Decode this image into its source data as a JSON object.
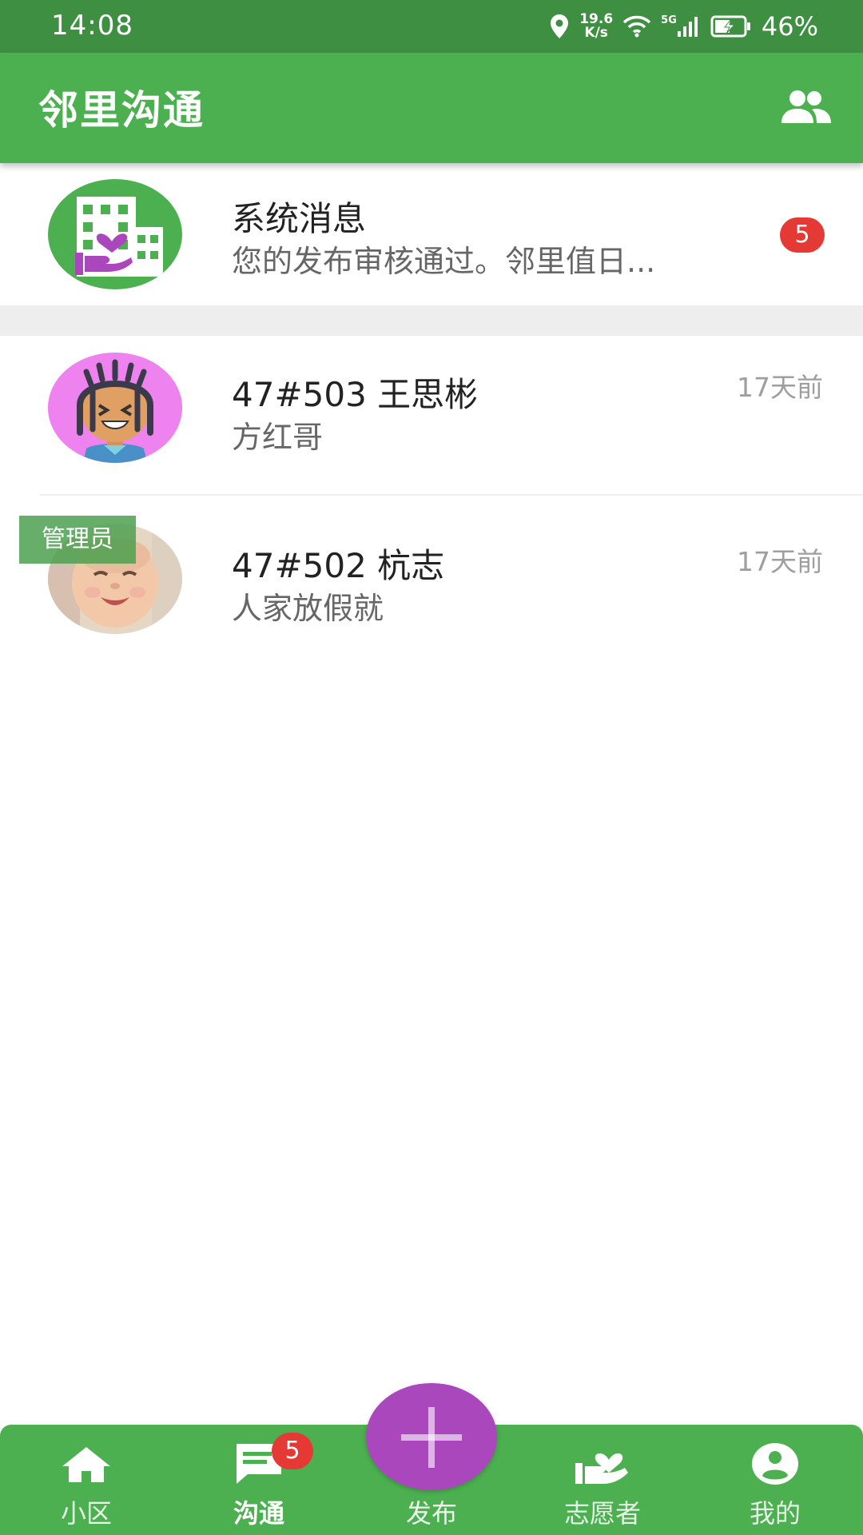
{
  "status_bar": {
    "time": "14:08",
    "net_speed_value": "19.6",
    "net_speed_unit": "K/s",
    "signal_label": "5G",
    "battery": "46%",
    "icons": [
      "location-icon",
      "wifi-icon",
      "signal-icon",
      "battery-charging-icon"
    ]
  },
  "app_bar": {
    "title": "邻里沟通",
    "action_icon": "contacts-icon"
  },
  "conversations": [
    {
      "name": "系统消息",
      "preview": "您的发布审核通过。邻里值日...",
      "unread": "5",
      "time": "",
      "avatar": "system-building-avatar"
    },
    {
      "name": "47#503 王思彬",
      "preview": "方红哥",
      "time": "17天前",
      "avatar": "cartoon-person-avatar"
    },
    {
      "name": "47#502 杭志",
      "preview": "人家放假就",
      "time": "17天前",
      "tag": "管理员",
      "avatar": "baby-photo-avatar"
    }
  ],
  "bottom_nav": {
    "items": [
      {
        "label": "小区",
        "icon": "home-icon"
      },
      {
        "label": "沟通",
        "icon": "chat-icon",
        "badge": "5",
        "active": true
      },
      {
        "label": "发布",
        "icon": "plus-icon"
      },
      {
        "label": "志愿者",
        "icon": "volunteer-heart-hand-icon"
      },
      {
        "label": "我的",
        "icon": "person-circle-icon"
      }
    ]
  },
  "colors": {
    "primary": "#4caf50",
    "status_bar": "#3f8f42",
    "accent_fab": "#ab47bc",
    "badge": "#e53935"
  }
}
